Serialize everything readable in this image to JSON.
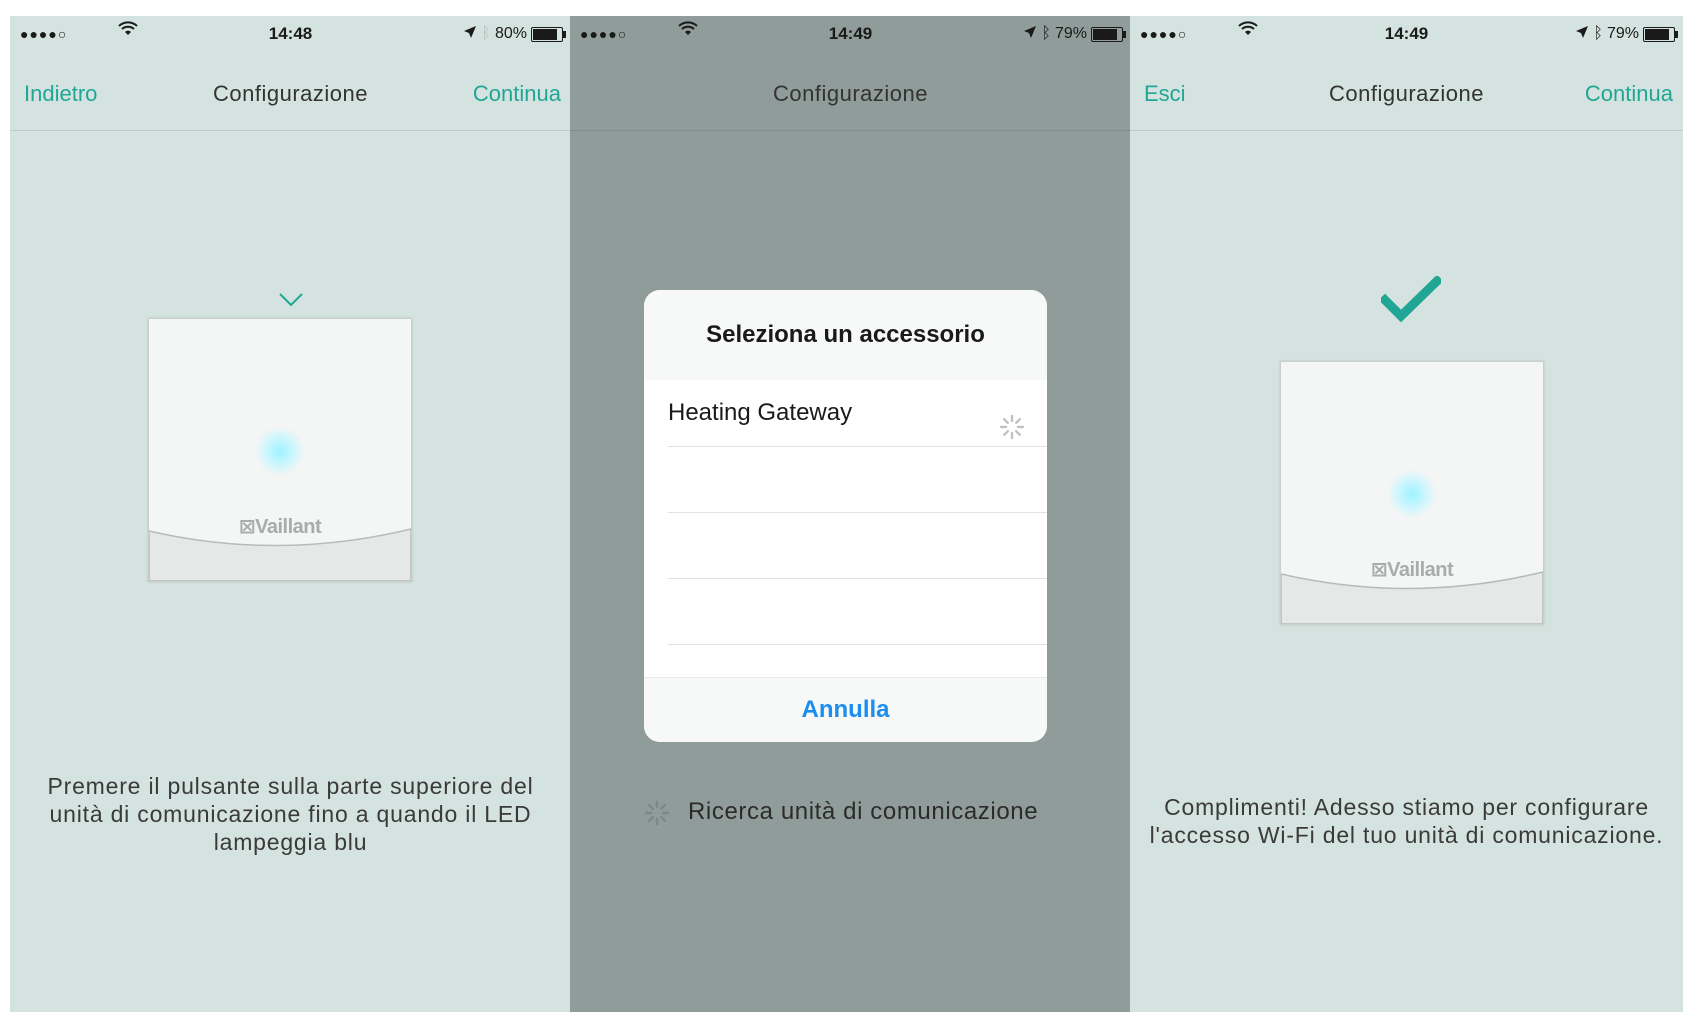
{
  "screens": [
    {
      "status": {
        "signal": "●●●●○",
        "time": "14:48",
        "battery_pct": "80%",
        "battery_level": 0.8
      },
      "nav": {
        "left": "Indietro",
        "title": "Configurazione",
        "right": "Continua"
      },
      "device_logo": "⊠Vaillant",
      "instruction": "Premere il pulsante sulla parte superiore del unità di comunicazione fino a quando il LED lampeggia blu"
    },
    {
      "status": {
        "signal": "●●●●○",
        "time": "14:49",
        "battery_pct": "79%",
        "battery_level": 0.79
      },
      "nav": {
        "title": "Configurazione"
      },
      "dialog": {
        "title": "Seleziona un accessorio",
        "items": [
          "Heating Gateway",
          "",
          "",
          ""
        ],
        "cancel": "Annulla"
      },
      "searching": "Ricerca unità di comunicazione"
    },
    {
      "status": {
        "signal": "●●●●○",
        "time": "14:49",
        "battery_pct": "79%",
        "battery_level": 0.79
      },
      "nav": {
        "left": "Esci",
        "title": "Configurazione",
        "right": "Continua"
      },
      "device_logo": "⊠Vaillant",
      "instruction": "Complimenti! Adesso stiamo per configurare l'accesso Wi-Fi del tuo unità di comunicazione."
    }
  ],
  "colors": {
    "accent": "#21a696",
    "link_blue": "#1b8ef0",
    "background": "#d4e3df",
    "overlay": "#909c99"
  },
  "icons": [
    "wifi-icon",
    "location-arrow-icon",
    "bluetooth-icon",
    "battery-icon",
    "chevron-down-icon",
    "checkmark-icon",
    "spinner-icon"
  ]
}
